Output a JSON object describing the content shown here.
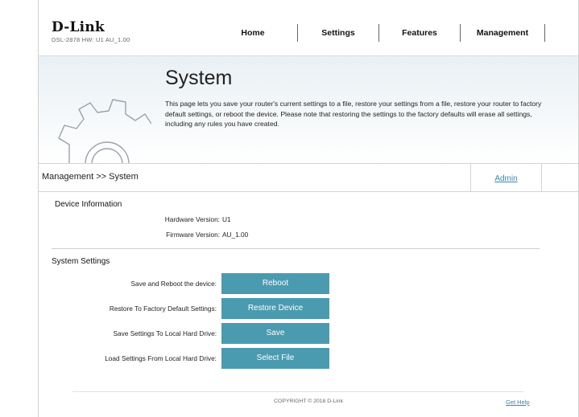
{
  "brand": {
    "logo": "D-Link",
    "model": "DSL-2878   HW: U1   AU_1.00"
  },
  "nav": {
    "home": "Home",
    "settings": "Settings",
    "features": "Features",
    "management": "Management"
  },
  "page": {
    "title": "System",
    "description": "This page lets you save your router's current settings to a file, restore your settings from a file, restore your router to factory default settings, or reboot the device. Please note that restoring the settings to the factory defaults will erase all settings, including any rules you have created."
  },
  "breadcrumb": "Management >> System",
  "admin_tab": "Admin",
  "device_info": {
    "title": "Device Information",
    "hardware_label": "Hardware Version:",
    "hardware_value": "U1",
    "firmware_label": "Firmware Version:",
    "firmware_value": "AU_1.00"
  },
  "system_settings": {
    "title": "System Settings",
    "rows": [
      {
        "label": "Save and Reboot the device:",
        "button": "Reboot"
      },
      {
        "label": "Restore To Factory Default Settings:",
        "button": "Restore Device"
      },
      {
        "label": "Save Settings To Local Hard Drive:",
        "button": "Save"
      },
      {
        "label": "Load Settings From Local Hard Drive:",
        "button": "Select File"
      }
    ]
  },
  "footer": {
    "copyright": "COPYRIGHT © 2018 D-Link",
    "help": "Get Help"
  },
  "colors": {
    "accent": "#4a9bb0",
    "link": "#3a86a8"
  }
}
